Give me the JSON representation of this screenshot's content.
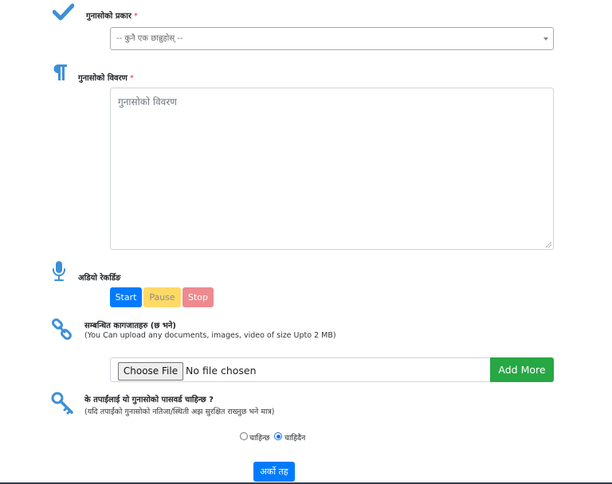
{
  "form": {
    "type_field": {
      "label": "गुनासोको प्रकार",
      "required_mark": "*",
      "placeholder": "-- कुनै एक छान्नुहोस् --"
    },
    "description_field": {
      "label": "गुनासोको विवरण",
      "required_mark": "*",
      "placeholder": "गुनासोको विवरण"
    },
    "audio": {
      "label": "अडियो रेकर्डिङ",
      "start_label": "Start",
      "pause_label": "Pause",
      "stop_label": "Stop"
    },
    "attachments": {
      "label": "सम्बन्धित कागजातहरु (छ भने)",
      "hint": "(You Can upload any documents, images, video of size Upto 2 MB)",
      "choose_label": "Choose File",
      "status": "No file chosen",
      "add_more_label": "Add More"
    },
    "password": {
      "label": "के तपाईंलाई यो गुनासोको पासवर्ड चाहिन्छ ?",
      "hint": "(यदि तपाईंको गुनासोको नतिजा/स्थिती अझ सुरक्षित राख्नुछ भने मात्र)",
      "options": [
        "चाहिन्छ",
        "चाहिदैन"
      ],
      "selected": "चाहिदैन"
    },
    "next_label": "अर्को तह"
  },
  "colors": {
    "icon_blue": "#3d8fd8",
    "primary": "#007bff",
    "warning": "#ffd966",
    "danger": "#ec8a8f",
    "success": "#28a745",
    "required": "#dc3545"
  },
  "icons": [
    "check-icon",
    "paragraph-icon",
    "microphone-icon",
    "link-icon",
    "key-icon"
  ]
}
